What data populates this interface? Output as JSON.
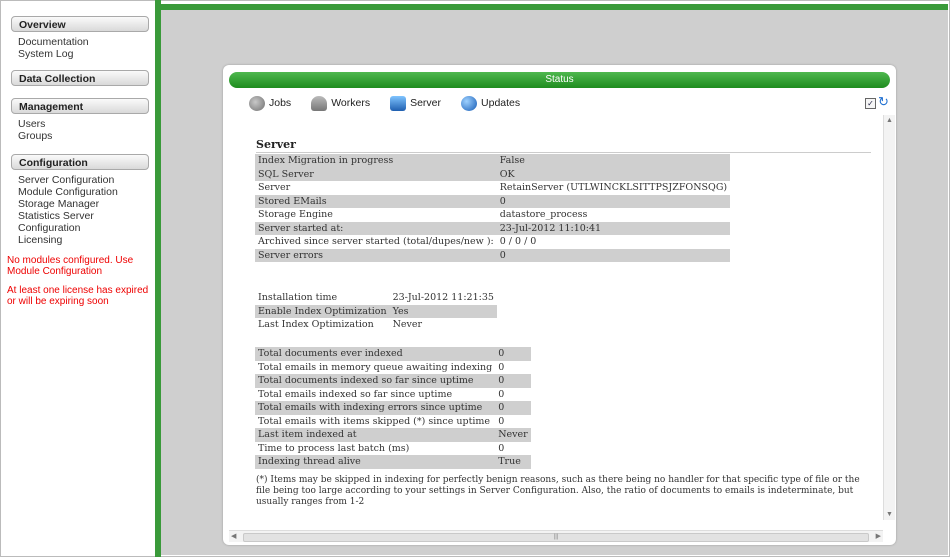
{
  "sidebar": {
    "overview_label": "Overview",
    "overview_items": [
      "Documentation",
      "System Log"
    ],
    "data_collection_label": "Data Collection",
    "management_label": "Management",
    "management_items": [
      "Users",
      "Groups"
    ],
    "configuration_label": "Configuration",
    "configuration_items": [
      "Server Configuration",
      "Module Configuration",
      "Storage Manager",
      "Statistics Server Configuration",
      "Licensing"
    ],
    "warning_1": "No modules configured. Use Module Configuration",
    "warning_2": "At least one license has expired or will be expiring soon"
  },
  "panel": {
    "title": "Status",
    "toolbar": [
      "Jobs",
      "Workers",
      "Server",
      "Updates"
    ],
    "checkbox_checked": true
  },
  "server": {
    "title": "Server",
    "rows": [
      [
        "Index Migration in progress",
        "False"
      ],
      [
        "SQL Server",
        "OK"
      ],
      [
        "Server",
        "RetainServer (UTLWINCKLSITTPSJZFONSQG)"
      ],
      [
        "Stored EMails",
        "0"
      ],
      [
        "Storage Engine",
        "datastore_process"
      ],
      [
        "Server started at:",
        "23-Jul-2012 11:10:41"
      ],
      [
        "Archived since server started (total/dupes/new ):",
        "0 / 0 / 0"
      ],
      [
        "Server errors",
        "0"
      ]
    ],
    "index_rows": [
      [
        "Installation time",
        "23-Jul-2012 11:21:35"
      ],
      [
        "Enable Index Optimization",
        "Yes"
      ],
      [
        "Last Index Optimization",
        "Never"
      ]
    ],
    "doc_rows": [
      [
        "Total documents ever indexed",
        "0"
      ],
      [
        "Total emails in memory queue awaiting indexing",
        "0"
      ],
      [
        "Total documents indexed so far since uptime",
        "0"
      ],
      [
        "Total emails indexed so far since uptime",
        "0"
      ],
      [
        "Total emails with indexing errors since uptime",
        "0"
      ],
      [
        "Total emails with items skipped (*) since uptime",
        "0"
      ],
      [
        "Last item indexed at",
        "Never"
      ],
      [
        "Time to process last batch (ms)",
        "0"
      ],
      [
        "Indexing thread alive",
        "True"
      ]
    ],
    "footnote": "(*) Items may be skipped in indexing for perfectly benign reasons, such as there being no handler for that specific type of file or the file being too large according to your settings in Server Configuration. Also, the ratio of documents to emails is indeterminate, but usually ranges from 1-2"
  },
  "colors": {
    "accent_green": "#3a9a3a",
    "warning_red": "#e00000"
  }
}
